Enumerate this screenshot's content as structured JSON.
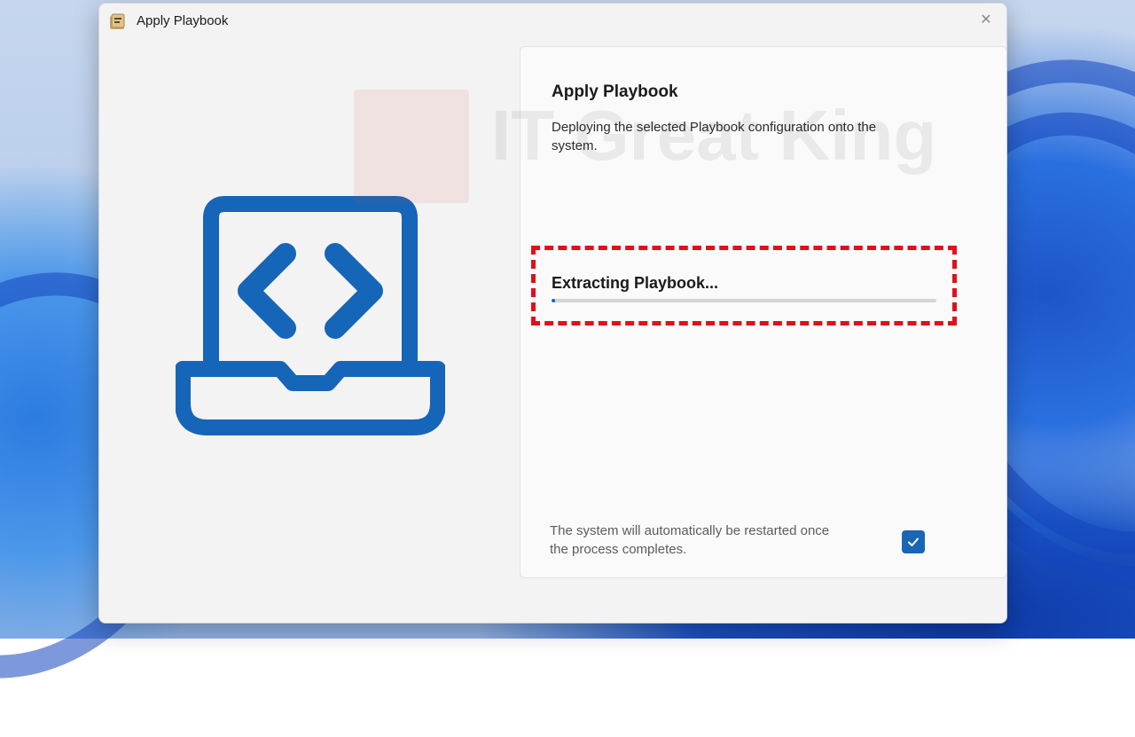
{
  "window": {
    "title": "Apply Playbook",
    "app_icon": "playbook-app-icon",
    "close_glyph": "✕"
  },
  "illustration": {
    "icon": "laptop-code-icon",
    "color": "#1565b8"
  },
  "panel": {
    "heading": "Apply Playbook",
    "description": "Deploying the selected Playbook configuration onto the system."
  },
  "watermark": {
    "text": "IT Great King"
  },
  "progress": {
    "label": "Extracting Playbook...",
    "percent": 1
  },
  "restart": {
    "note": "The system will automatically be restarted once the process completes.",
    "auto_restart_checked": true
  },
  "colors": {
    "accent": "#1a66b5",
    "highlight_border": "#e0101a"
  }
}
